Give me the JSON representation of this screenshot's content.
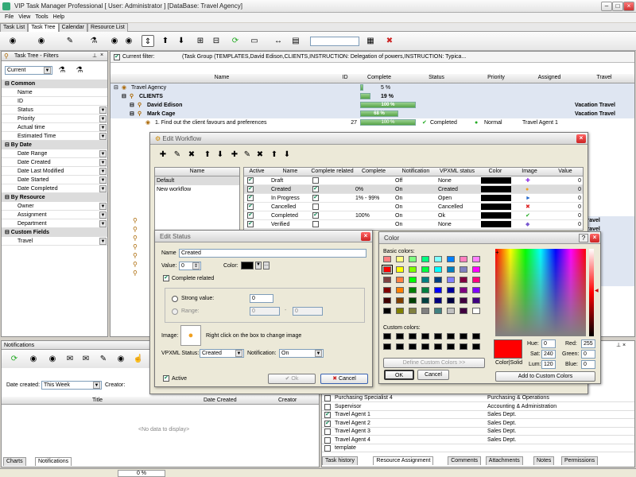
{
  "window": {
    "title": "VIP Task Manager Professional [ User: Administrator ] [DataBase: Travel Agency]"
  },
  "menu": [
    "File",
    "View",
    "Tools",
    "Help"
  ],
  "tabs": [
    "Task List",
    "Task Tree",
    "Calendar",
    "Resource List"
  ],
  "filter_panel": {
    "title": "Task Tree - Filters",
    "combo": "Current",
    "groups": [
      {
        "name": "Common",
        "items": [
          "Name",
          "ID",
          "Status",
          "Priority",
          "Actual time",
          "Estimated Time"
        ]
      },
      {
        "name": "By Date",
        "items": [
          "Date Range",
          "Date Created",
          "Date Last Modified",
          "Date Started",
          "Date Completed"
        ]
      },
      {
        "name": "By Resource",
        "items": [
          "Owner",
          "Assignment",
          "Department"
        ]
      },
      {
        "name": "Custom Fields",
        "items": [
          "Travel"
        ]
      }
    ]
  },
  "current_filter": {
    "label": "Current filter:",
    "text": "(Task Group  (TEMPLATES,David Edison,CLIENTS,INSTRUCTION: Delegation of powers,INSTRUCTION: Typica..."
  },
  "tree": {
    "columns": [
      "Name",
      "ID",
      "Complete",
      "Status",
      "Priority",
      "Assigned",
      "Travel"
    ],
    "rows": [
      {
        "name": "Travel Agency",
        "id": "",
        "complete": "5 %",
        "pct": 0.05,
        "status": "",
        "priority": "",
        "assigned": "",
        "travel": "",
        "bold": false
      },
      {
        "name": "CLIENTS",
        "id": "",
        "complete": "19 %",
        "pct": 0.19,
        "status": "",
        "priority": "",
        "assigned": "",
        "travel": "",
        "bold": true
      },
      {
        "name": "David Edison",
        "id": "",
        "complete": "100 %",
        "pct": 1.0,
        "status": "",
        "priority": "",
        "assigned": "",
        "travel": "Vacation Travel",
        "bold": true
      },
      {
        "name": "Mark Cage",
        "id": "",
        "complete": "68 %",
        "pct": 0.68,
        "status": "",
        "priority": "",
        "assigned": "",
        "travel": "Vacation Travel",
        "bold": true
      },
      {
        "name": "1. Find out the client favours and preferences",
        "id": "27",
        "complete": "100 %",
        "pct": 1.0,
        "status": "Completed",
        "priority": "Normal",
        "assigned": "Travel Agent 1",
        "travel": "",
        "bold": false
      }
    ],
    "right_travel": [
      "ess Travel",
      "ess Travel",
      "kSpecials",
      "kSpecials",
      "avel",
      "avel",
      "avel",
      "avel"
    ]
  },
  "edit_workflow": {
    "title": "Edit Workflow",
    "list_header": "Name",
    "list": [
      "Default",
      "New workflow"
    ],
    "columns": [
      "Active",
      "Name",
      "Complete related",
      "Complete",
      "Notification",
      "VPXML status",
      "Color",
      "Image",
      "Value"
    ],
    "rows": [
      {
        "name": "Draft",
        "cr": false,
        "complete": "",
        "notif": "Off",
        "vp": "None",
        "img": "✚",
        "imgc": "#8a2be2",
        "value": "0"
      },
      {
        "name": "Created",
        "cr": true,
        "complete": "0%",
        "notif": "On",
        "vp": "Created",
        "img": "●",
        "imgc": "#f0a020",
        "value": "0"
      },
      {
        "name": "In Progress",
        "cr": true,
        "complete": "1% - 99%",
        "notif": "On",
        "vp": "Open",
        "img": "►",
        "imgc": "#2266cc",
        "value": "0"
      },
      {
        "name": "Cancelled",
        "cr": false,
        "complete": "",
        "notif": "On",
        "vp": "Cancelled",
        "img": "✖",
        "imgc": "#d22",
        "value": "0"
      },
      {
        "name": "Completed",
        "cr": true,
        "complete": "100%",
        "notif": "On",
        "vp": "Ok",
        "img": "✔",
        "imgc": "#2a2",
        "value": "0"
      },
      {
        "name": "Verified",
        "cr": false,
        "complete": "",
        "notif": "On",
        "vp": "None",
        "img": "◆",
        "imgc": "#7a5ad0",
        "value": "0"
      }
    ]
  },
  "edit_status": {
    "title": "Edit Status",
    "name_label": "Name",
    "name": "Created",
    "value_label": "Value:",
    "value": "0",
    "color_label": "Color:",
    "complete_related": "Complete related",
    "strong_label": "Strong value:",
    "strong_value": "0",
    "range_label": "Range:",
    "range_from": "0",
    "range_to": "0",
    "image_label": "Image:",
    "image_hint": "Right click on the box to  change image",
    "vpxml_label": "VPXML Status:",
    "vpxml": "Created",
    "notif_label": "Notification:",
    "notif": "On",
    "active": "Active",
    "ok": "Ok",
    "cancel": "Cancel"
  },
  "color_dialog": {
    "title": "Color",
    "basic": "Basic colors:",
    "custom": "Custom colors:",
    "define": "Define Custom Colors >>",
    "ok": "OK",
    "cancel": "Cancel",
    "colorsolid": "Color|Solid",
    "hue_l": "Hue:",
    "hue": "0",
    "sat_l": "Sat:",
    "sat": "240",
    "lum_l": "Lum:",
    "lum": "120",
    "red_l": "Red:",
    "red": "255",
    "green_l": "Green:",
    "green": "0",
    "blue_l": "Blue:",
    "blue": "0",
    "add": "Add to Custom Colors",
    "basic_colors": [
      "#ff8080",
      "#ffff80",
      "#80ff80",
      "#00ff80",
      "#80ffff",
      "#0080ff",
      "#ff80c0",
      "#ff80ff",
      "#ff0000",
      "#ffff00",
      "#80ff00",
      "#00ff40",
      "#00ffff",
      "#0080c0",
      "#8080c0",
      "#ff00ff",
      "#804040",
      "#ff8040",
      "#00ff00",
      "#008080",
      "#004080",
      "#8080ff",
      "#800040",
      "#ff0080",
      "#800000",
      "#ff8000",
      "#008000",
      "#008040",
      "#0000ff",
      "#0000a0",
      "#800080",
      "#8000ff",
      "#400000",
      "#804000",
      "#004000",
      "#004040",
      "#000080",
      "#000040",
      "#400040",
      "#400080",
      "#000000",
      "#808000",
      "#808040",
      "#808080",
      "#408080",
      "#c0c0c0",
      "#400040",
      "#ffffff"
    ]
  },
  "notifications": {
    "title": "Notifications",
    "date_label": "Date created:",
    "date": "This Week",
    "creator_label": "Creator:",
    "columns": [
      "Title",
      "Date Created",
      "Creator"
    ],
    "empty": "<No data to display>",
    "tabs": [
      "Charts",
      "Notifications"
    ]
  },
  "resources": {
    "rows": [
      {
        "name": "Purchasing Specialist 4",
        "dept": "Purchasing & Operations",
        "checked": false
      },
      {
        "name": "Supervisor",
        "dept": "Accounting & Administration",
        "checked": false
      },
      {
        "name": "Travel Agent 1",
        "dept": "Sales Dept.",
        "checked": true
      },
      {
        "name": "Travel Agent 2",
        "dept": "Sales Dept.",
        "checked": true
      },
      {
        "name": "Travel Agent 3",
        "dept": "Sales Dept.",
        "checked": false
      },
      {
        "name": "Travel Agent 4",
        "dept": "Sales Dept.",
        "checked": false
      },
      {
        "name": "template",
        "dept": "",
        "checked": false
      }
    ],
    "tabs": [
      "Task history",
      "Resource Assignment",
      "Comments",
      "Attachments",
      "Notes",
      "Permissions"
    ]
  },
  "status": {
    "progress": "0 %"
  },
  "colors": {
    "selected": "#000000",
    "red": "#ff0000"
  }
}
